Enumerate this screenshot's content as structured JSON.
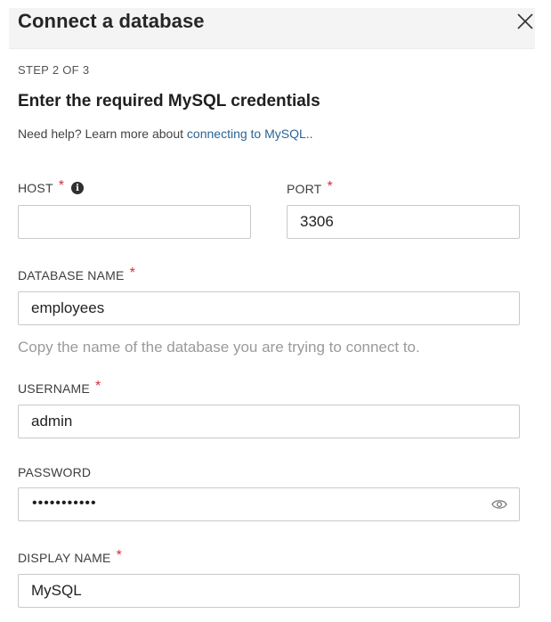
{
  "dialog": {
    "title": "Connect a database",
    "step": "STEP 2 OF 3",
    "subtitle": "Enter the required MySQL credentials",
    "help_prefix": "Need help? Learn more about ",
    "help_link": "connecting to MySQL.."
  },
  "fields": {
    "host": {
      "label": "HOST",
      "value": ""
    },
    "port": {
      "label": "PORT",
      "value": "3306"
    },
    "database_name": {
      "label": "DATABASE NAME",
      "value": "employees",
      "hint": "Copy the name of the database you are trying to connect to."
    },
    "username": {
      "label": "USERNAME",
      "value": "admin"
    },
    "password": {
      "label": "PASSWORD",
      "masked": "•••••••••••"
    },
    "display_name": {
      "label": "DISPLAY NAME",
      "value": "MySQL"
    }
  },
  "required_marker": "*",
  "icons": {
    "close": "close-icon",
    "info": "info-icon",
    "eye": "eye-icon"
  },
  "colors": {
    "required": "#d0313a",
    "link": "#2a6496"
  }
}
